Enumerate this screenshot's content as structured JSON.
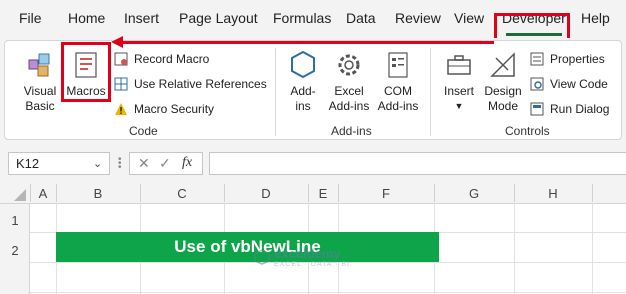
{
  "menu": {
    "tabs": [
      "File",
      "Home",
      "Insert",
      "Page Layout",
      "Formulas",
      "Data",
      "Review",
      "View",
      "Developer",
      "Help"
    ],
    "active_tab": "Developer"
  },
  "ribbon": {
    "code": {
      "label": "Code",
      "visual_basic": [
        "Visual",
        "Basic"
      ],
      "macros": "Macros",
      "record_macro": "Record Macro",
      "relative_refs": "Use Relative References",
      "macro_security": "Macro Security"
    },
    "addins": {
      "label": "Add-ins",
      "addins": [
        "Add-",
        "ins"
      ],
      "excel_addins": [
        "Excel",
        "Add-ins"
      ],
      "com_addins": [
        "COM",
        "Add-ins"
      ]
    },
    "controls": {
      "label": "Controls",
      "insert": "Insert",
      "design_mode": [
        "Design",
        "Mode"
      ],
      "properties": "Properties",
      "view_code": "View Code",
      "run_dialog": "Run Dialog"
    }
  },
  "formula_bar": {
    "name_box": "K12",
    "fx": "fx",
    "formula": ""
  },
  "grid": {
    "columns": [
      "A",
      "B",
      "C",
      "D",
      "E",
      "F",
      "G",
      "H"
    ],
    "rows": [
      "1",
      "2"
    ],
    "title_cell": "Use of vbNewLine"
  },
  "watermark": {
    "name": "exceldemy",
    "sub": "EXCEL · DATA · BI"
  },
  "colors": {
    "accent_red": "#e1001a",
    "excel_green": "#1e6b3a",
    "title_fill": "#0ea54a"
  }
}
